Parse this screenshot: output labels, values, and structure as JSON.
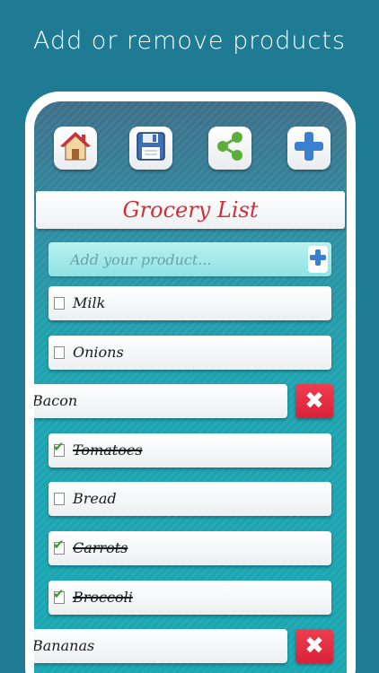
{
  "headline": "Add or remove products",
  "toolbar": {
    "home_icon": "home-icon",
    "save_icon": "floppy-disk-icon",
    "share_icon": "share-icon",
    "add_icon": "plus-icon"
  },
  "list_title": "Grocery List",
  "add_field": {
    "placeholder": "Add your product..."
  },
  "items": [
    {
      "label": "Milk",
      "checked": false,
      "swiped": false
    },
    {
      "label": "Onions",
      "checked": false,
      "swiped": false
    },
    {
      "label": "Bacon",
      "checked": false,
      "swiped": true
    },
    {
      "label": "Tomatoes",
      "checked": true,
      "swiped": false
    },
    {
      "label": "Bread",
      "checked": false,
      "swiped": false
    },
    {
      "label": "Carrots",
      "checked": true,
      "swiped": false
    },
    {
      "label": "Broccoli",
      "checked": true,
      "swiped": false
    },
    {
      "label": "Bananas",
      "checked": false,
      "swiped": true
    }
  ],
  "delete_glyph": "✖",
  "colors": {
    "accent": "#c8323a",
    "background": "#1f7a93",
    "delete": "#e0293f"
  }
}
